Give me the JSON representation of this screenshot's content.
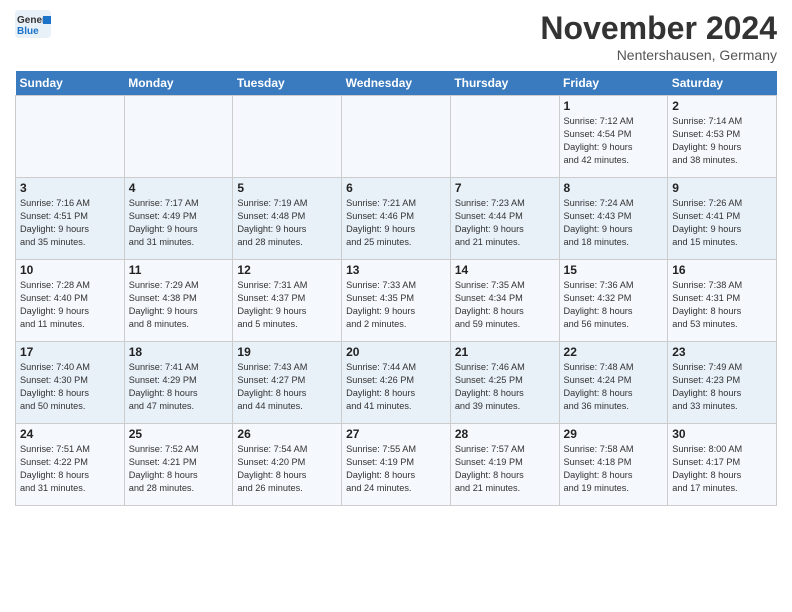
{
  "header": {
    "logo_general": "General",
    "logo_blue": "Blue",
    "month_title": "November 2024",
    "location": "Nentershausen, Germany"
  },
  "weekdays": [
    "Sunday",
    "Monday",
    "Tuesday",
    "Wednesday",
    "Thursday",
    "Friday",
    "Saturday"
  ],
  "weeks": [
    [
      {
        "day": "",
        "info": ""
      },
      {
        "day": "",
        "info": ""
      },
      {
        "day": "",
        "info": ""
      },
      {
        "day": "",
        "info": ""
      },
      {
        "day": "",
        "info": ""
      },
      {
        "day": "1",
        "info": "Sunrise: 7:12 AM\nSunset: 4:54 PM\nDaylight: 9 hours\nand 42 minutes."
      },
      {
        "day": "2",
        "info": "Sunrise: 7:14 AM\nSunset: 4:53 PM\nDaylight: 9 hours\nand 38 minutes."
      }
    ],
    [
      {
        "day": "3",
        "info": "Sunrise: 7:16 AM\nSunset: 4:51 PM\nDaylight: 9 hours\nand 35 minutes."
      },
      {
        "day": "4",
        "info": "Sunrise: 7:17 AM\nSunset: 4:49 PM\nDaylight: 9 hours\nand 31 minutes."
      },
      {
        "day": "5",
        "info": "Sunrise: 7:19 AM\nSunset: 4:48 PM\nDaylight: 9 hours\nand 28 minutes."
      },
      {
        "day": "6",
        "info": "Sunrise: 7:21 AM\nSunset: 4:46 PM\nDaylight: 9 hours\nand 25 minutes."
      },
      {
        "day": "7",
        "info": "Sunrise: 7:23 AM\nSunset: 4:44 PM\nDaylight: 9 hours\nand 21 minutes."
      },
      {
        "day": "8",
        "info": "Sunrise: 7:24 AM\nSunset: 4:43 PM\nDaylight: 9 hours\nand 18 minutes."
      },
      {
        "day": "9",
        "info": "Sunrise: 7:26 AM\nSunset: 4:41 PM\nDaylight: 9 hours\nand 15 minutes."
      }
    ],
    [
      {
        "day": "10",
        "info": "Sunrise: 7:28 AM\nSunset: 4:40 PM\nDaylight: 9 hours\nand 11 minutes."
      },
      {
        "day": "11",
        "info": "Sunrise: 7:29 AM\nSunset: 4:38 PM\nDaylight: 9 hours\nand 8 minutes."
      },
      {
        "day": "12",
        "info": "Sunrise: 7:31 AM\nSunset: 4:37 PM\nDaylight: 9 hours\nand 5 minutes."
      },
      {
        "day": "13",
        "info": "Sunrise: 7:33 AM\nSunset: 4:35 PM\nDaylight: 9 hours\nand 2 minutes."
      },
      {
        "day": "14",
        "info": "Sunrise: 7:35 AM\nSunset: 4:34 PM\nDaylight: 8 hours\nand 59 minutes."
      },
      {
        "day": "15",
        "info": "Sunrise: 7:36 AM\nSunset: 4:32 PM\nDaylight: 8 hours\nand 56 minutes."
      },
      {
        "day": "16",
        "info": "Sunrise: 7:38 AM\nSunset: 4:31 PM\nDaylight: 8 hours\nand 53 minutes."
      }
    ],
    [
      {
        "day": "17",
        "info": "Sunrise: 7:40 AM\nSunset: 4:30 PM\nDaylight: 8 hours\nand 50 minutes."
      },
      {
        "day": "18",
        "info": "Sunrise: 7:41 AM\nSunset: 4:29 PM\nDaylight: 8 hours\nand 47 minutes."
      },
      {
        "day": "19",
        "info": "Sunrise: 7:43 AM\nSunset: 4:27 PM\nDaylight: 8 hours\nand 44 minutes."
      },
      {
        "day": "20",
        "info": "Sunrise: 7:44 AM\nSunset: 4:26 PM\nDaylight: 8 hours\nand 41 minutes."
      },
      {
        "day": "21",
        "info": "Sunrise: 7:46 AM\nSunset: 4:25 PM\nDaylight: 8 hours\nand 39 minutes."
      },
      {
        "day": "22",
        "info": "Sunrise: 7:48 AM\nSunset: 4:24 PM\nDaylight: 8 hours\nand 36 minutes."
      },
      {
        "day": "23",
        "info": "Sunrise: 7:49 AM\nSunset: 4:23 PM\nDaylight: 8 hours\nand 33 minutes."
      }
    ],
    [
      {
        "day": "24",
        "info": "Sunrise: 7:51 AM\nSunset: 4:22 PM\nDaylight: 8 hours\nand 31 minutes."
      },
      {
        "day": "25",
        "info": "Sunrise: 7:52 AM\nSunset: 4:21 PM\nDaylight: 8 hours\nand 28 minutes."
      },
      {
        "day": "26",
        "info": "Sunrise: 7:54 AM\nSunset: 4:20 PM\nDaylight: 8 hours\nand 26 minutes."
      },
      {
        "day": "27",
        "info": "Sunrise: 7:55 AM\nSunset: 4:19 PM\nDaylight: 8 hours\nand 24 minutes."
      },
      {
        "day": "28",
        "info": "Sunrise: 7:57 AM\nSunset: 4:19 PM\nDaylight: 8 hours\nand 21 minutes."
      },
      {
        "day": "29",
        "info": "Sunrise: 7:58 AM\nSunset: 4:18 PM\nDaylight: 8 hours\nand 19 minutes."
      },
      {
        "day": "30",
        "info": "Sunrise: 8:00 AM\nSunset: 4:17 PM\nDaylight: 8 hours\nand 17 minutes."
      }
    ]
  ]
}
